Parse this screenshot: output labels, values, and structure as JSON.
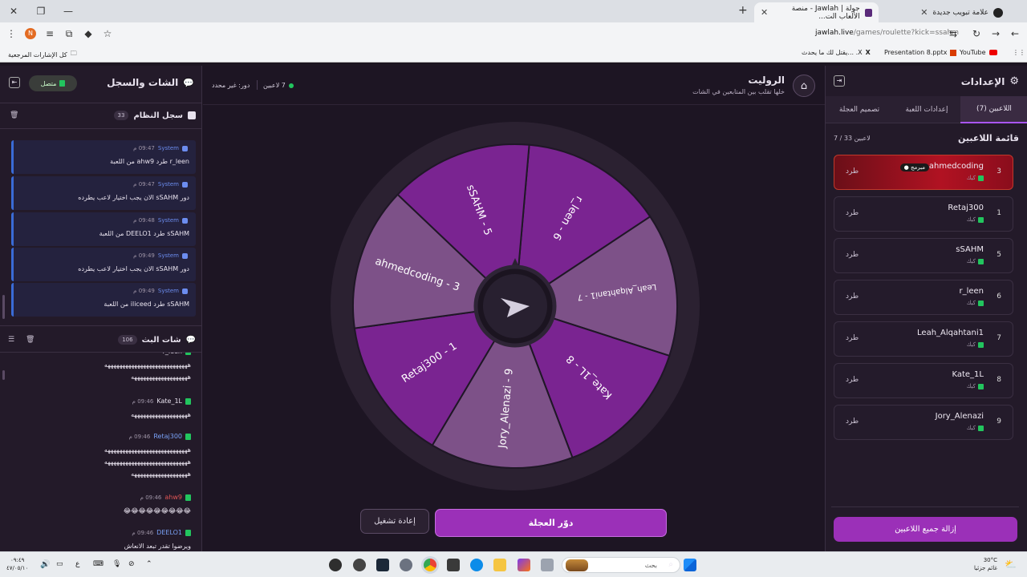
{
  "browser": {
    "tabs": [
      {
        "title": "جولة | Jawlah - منصة الألعاب الت..."
      },
      {
        "title": "علامة تبويب جديدة"
      }
    ],
    "url": {
      "host": "jawlah.live",
      "path": "/games/roulette?kick=ssahm"
    },
    "bookmarks": {
      "all_label": "كل الإشارات المرجعية",
      "items": [
        "YouTube",
        "Presentation 8.pptx",
        "يقتل لك ما يحدث... .X"
      ]
    }
  },
  "settings": {
    "title": "الإعدادات",
    "tabs": [
      "اللاعبين (7)",
      "إعدادات اللعبة",
      "تصميم العجلة"
    ],
    "players_title": "قائمة اللاعبين",
    "players_count": "7 / 33 لاعبين",
    "players": [
      {
        "num": "3",
        "name": "ahmedcoding",
        "status": "كيك",
        "badge": "مبرمج",
        "kick": "طرد",
        "highlight": true
      },
      {
        "num": "1",
        "name": "Retaj300",
        "status": "كيك",
        "kick": "طرد"
      },
      {
        "num": "5",
        "name": "sSAHM",
        "status": "كيك",
        "kick": "طرد"
      },
      {
        "num": "6",
        "name": "r_leen",
        "status": "كيك",
        "kick": "طرد"
      },
      {
        "num": "7",
        "name": "Leah_Alqahtani1",
        "status": "كيك",
        "kick": "طرد"
      },
      {
        "num": "8",
        "name": "Kate_1L",
        "status": "كيك",
        "kick": "طرد"
      },
      {
        "num": "9",
        "name": "Jory_Alenazi",
        "status": "كيك",
        "kick": "طرد"
      }
    ],
    "remove_all": "إزالة جميع اللاعبين"
  },
  "game": {
    "title": "الروليت",
    "subtitle": "خلها تقلب بين المتابعين في الشات",
    "players_online": "7 لاعبين",
    "turn": "دور: غير محدد",
    "wheel": [
      {
        "label": "r_leen - 6"
      },
      {
        "label": "Leah_Alqahtani1 - 7"
      },
      {
        "label": "Kate_1L - 8"
      },
      {
        "label": "Jory_Alenazi - 9"
      },
      {
        "label": "Retaj300 - 1"
      },
      {
        "label": "ahmedcoding - 3"
      },
      {
        "label": "sSAHM - 5"
      }
    ],
    "spin_label": "دوّر العجلة",
    "restart_label": "إعادة تشغيل"
  },
  "chat_panel": {
    "title": "الشات والسجل",
    "connection": "متصل",
    "system_log": {
      "title": "سجل النظام",
      "count": "33",
      "messages": [
        {
          "sender": "System",
          "time": "09:47 م",
          "text": "r_leen طرد ahw9 من اللعبة"
        },
        {
          "sender": "System",
          "time": "09:47 م",
          "text": "دور sSAHM الان يجب اختيار لاعب يطرده"
        },
        {
          "sender": "System",
          "time": "09:48 م",
          "text": "sSAHM طرد DEELO1 من اللعبة"
        },
        {
          "sender": "System",
          "time": "09:49 م",
          "text": "دور sSAHM الان يجب اختيار لاعب يطرده"
        },
        {
          "sender": "System",
          "time": "09:49 م",
          "text": "sSAHM طرد iliceed من اللعبة"
        }
      ]
    },
    "live_chat": {
      "title": "شات البث",
      "count": "106",
      "messages": [
        {
          "name": "r_leen",
          "time": "",
          "name_color": "#e8e2ee",
          "lines": [
            "ههههههههههههههههههههههههههههه",
            "هههههههههههههههههههه"
          ]
        },
        {
          "name": "Kate_1L",
          "time": "09:46 م",
          "name_color": "#e8e2ee",
          "lines": [
            "هههههههههههههههههههه"
          ]
        },
        {
          "name": "Retaj300",
          "time": "09:46 م",
          "name_color": "#7aa2f7",
          "lines": [
            "ههههههههههههههههههههههههههههه",
            "ههههههههههههههههههههههههههههه",
            "هههههههههههههههههههه"
          ]
        },
        {
          "name": "ahw9",
          "time": "09:46 م",
          "name_color": "#e05555",
          "lines": [
            "😂😂😂😂😂😂😂😂😂"
          ]
        },
        {
          "name": "DEELO1",
          "time": "09:46 م",
          "name_color": "#7aa2f7",
          "lines": [
            "ويرضوا تقدر تبعد الانعاش"
          ]
        }
      ]
    }
  },
  "taskbar": {
    "search": "بحث",
    "weather_temp": "30°C",
    "weather_desc": "غائم جزئيا",
    "clock_time": "٠٩:٤٩",
    "clock_date": "٤٧/٠٥/١٠",
    "lang": "ع"
  },
  "colors": {
    "wheel_dark": "#7a2491",
    "wheel_light": "#7d5188",
    "accent": "#9b30b8",
    "bg": "#1d1622"
  }
}
